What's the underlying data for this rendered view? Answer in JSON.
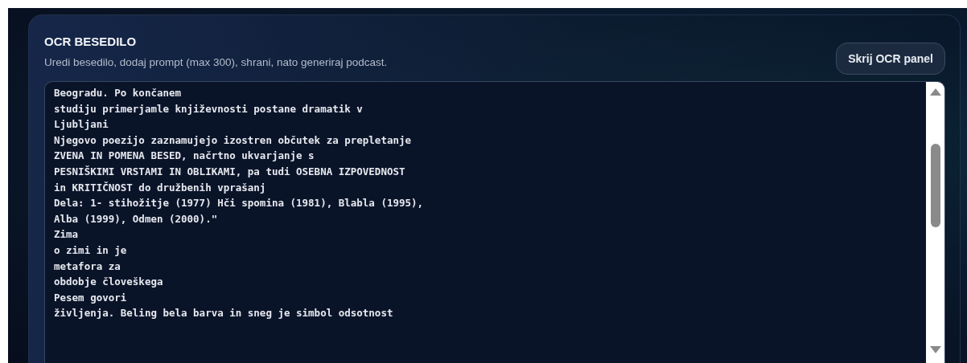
{
  "panel": {
    "title": "OCR BESEDILO",
    "subtitle": "Uredi besedilo, dodaj prompt (max 300), shrani, nato generiraj podcast.",
    "toggle_button": "Skrij OCR panel"
  },
  "ocr_text": [
    "Beogradu. Po končanem",
    "studiju primerjamle književnosti postane dramatik v",
    "Ljubljani",
    "Njegovo poezijo zaznamujejo izostren občutek za prepletanje",
    "ZVENA IN POMENA BESED, načrtno ukvarjanje s",
    "PESNIŠKIMI VRSTAMI IN OBLIKAMI, pa tudi OSEBNA IZPOVEDNOST",
    "in KRITIČNOST do družbenih vprašanj",
    "Dela: 1- stihožitje (1977) Hči spomina (1981), Blabla (1995),",
    "Alba (1999), Odmen (2000).\"",
    "Zima",
    "o zimi in je",
    "metafora za",
    "obdobje človeškega",
    "Pesem govori",
    "življenja. Beling bela barva in sneg je simbol odsotnost"
  ]
}
